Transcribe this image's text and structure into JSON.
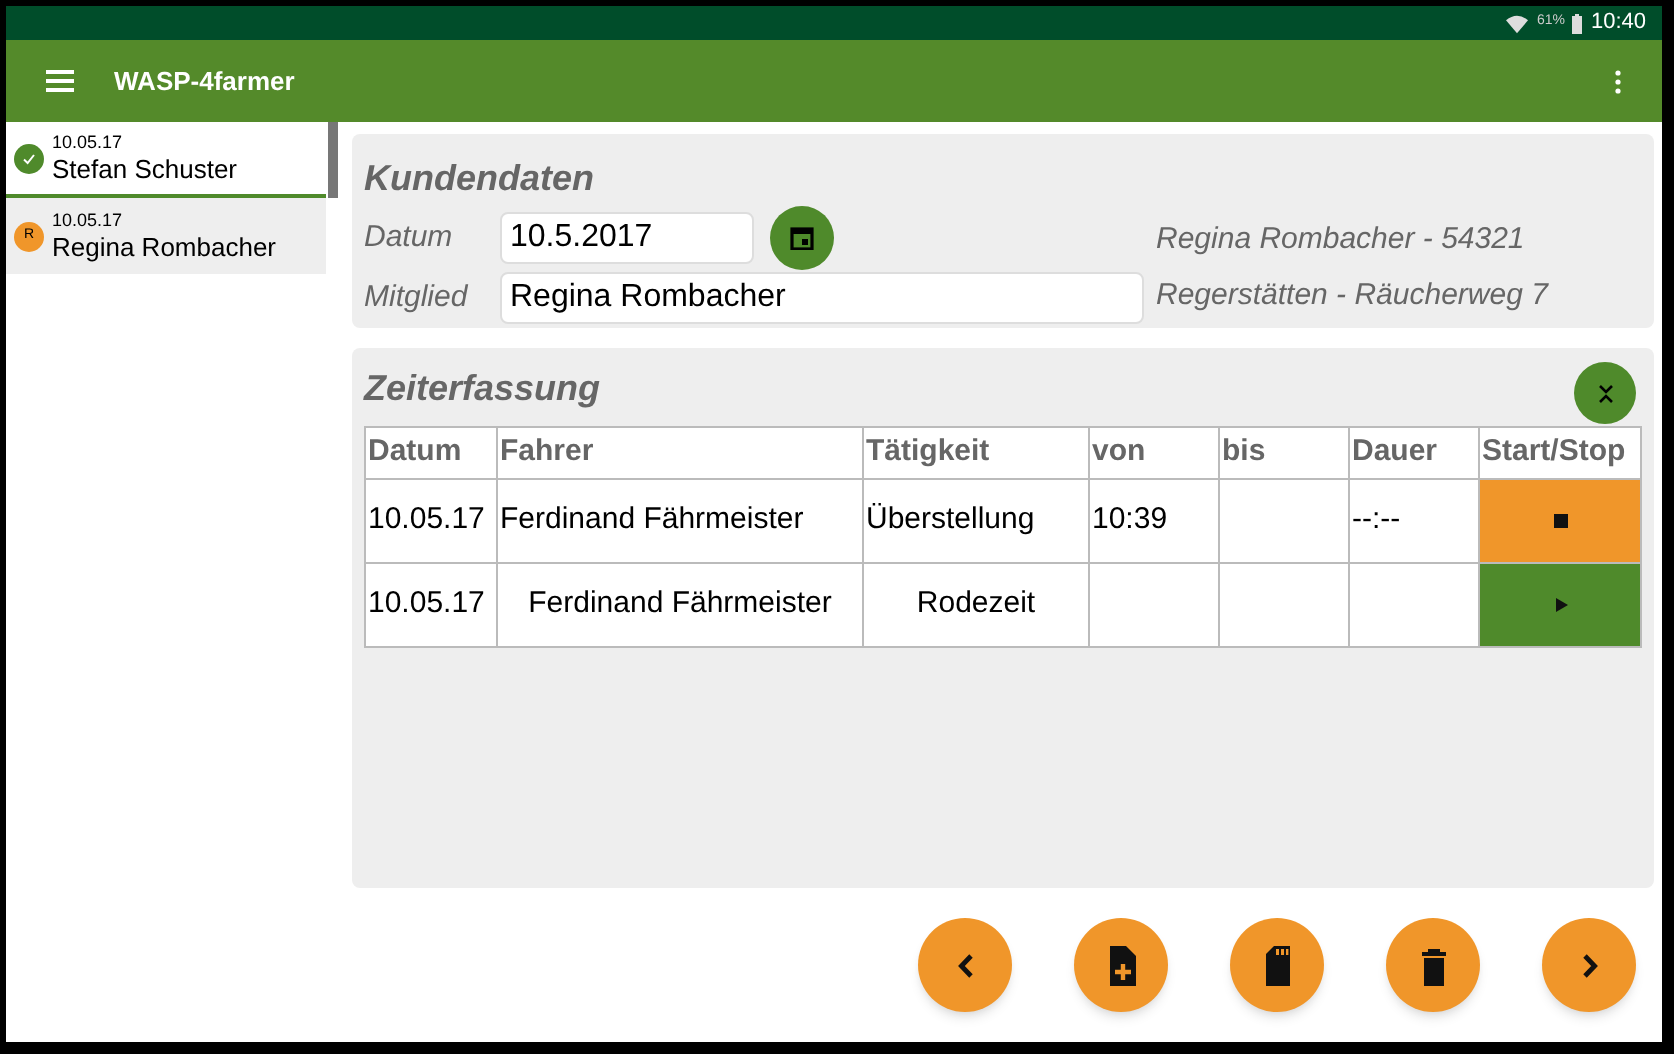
{
  "status_bar": {
    "battery": "61%",
    "time": "10:40"
  },
  "app_bar": {
    "title": "WASP-4farmer"
  },
  "sidebar": {
    "items": [
      {
        "date": "10.05.17",
        "name": "Stefan Schuster",
        "kind": "check",
        "color": "#4f8a2b",
        "selected": false
      },
      {
        "date": "10.05.17",
        "name": "Regina Rombacher",
        "kind": "letter",
        "badge": "R",
        "color": "#f0962a",
        "selected": true
      }
    ]
  },
  "customer": {
    "title": "Kundendaten",
    "date_label": "Datum",
    "date_value": "10.5.2017",
    "member_label": "Mitglied",
    "member_value": "Regina Rombacher",
    "info_lines": [
      "Regina Rombacher - 54321",
      "Regerstätten - Räucherweg 7"
    ]
  },
  "time_tracking": {
    "title": "Zeiterfassung",
    "columns": [
      "Datum",
      "Fahrer",
      "Tätigkeit",
      "von",
      "bis",
      "Dauer",
      "Start/Stop"
    ],
    "rows": [
      {
        "kind": "running",
        "cells": [
          "10.05.17",
          "Ferdinand Fährmeister",
          "Überstellung",
          "10:39",
          "",
          "--:--"
        ]
      },
      {
        "kind": "idle",
        "cells": [
          "10.05.17",
          "Ferdinand Fährmeister",
          "Rodezeit",
          "",
          "",
          ""
        ]
      }
    ]
  },
  "footer_buttons": [
    {
      "kind": "previous"
    },
    {
      "kind": "new"
    },
    {
      "kind": "save"
    },
    {
      "kind": "delete"
    },
    {
      "kind": "next"
    }
  ]
}
